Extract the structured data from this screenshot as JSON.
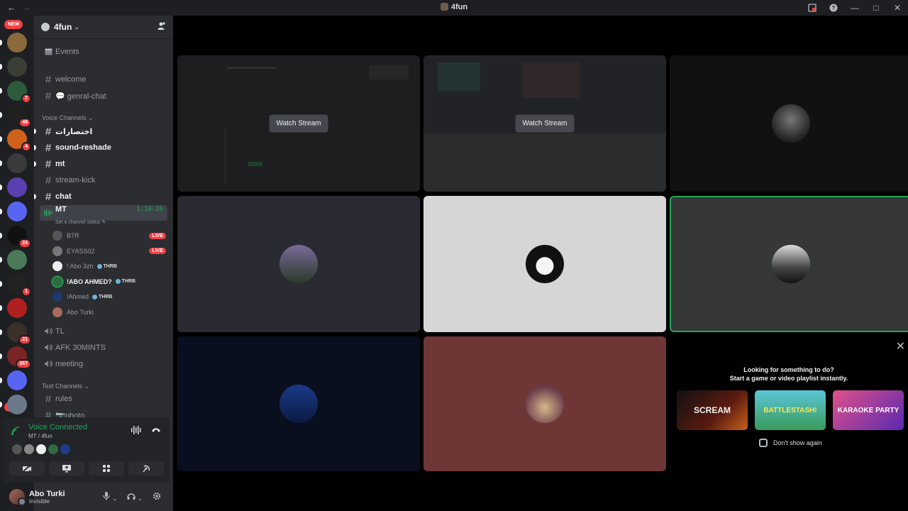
{
  "titlebar": {
    "title": "4fun",
    "back": "←",
    "forward": "→"
  },
  "rail": {
    "new_top": "NEW",
    "new_bottom": "NEW",
    "servers": [
      {
        "color": "#8a6a3a",
        "badge": ""
      },
      {
        "color": "#3a3f35",
        "badge": ""
      },
      {
        "color": "#2d5a3a",
        "badge": "7"
      },
      {
        "color": "#202020",
        "badge": "49"
      },
      {
        "color": "#d0611a",
        "badge": "4"
      },
      {
        "color": "#3a3a3a",
        "badge": ""
      },
      {
        "color": "#5a3fb0",
        "badge": ""
      },
      {
        "color": "#5865f2",
        "badge": ""
      },
      {
        "color": "#111111",
        "badge": "24"
      },
      {
        "color": "#4a7a58",
        "badge": ""
      },
      {
        "color": "#222222",
        "badge": "1"
      },
      {
        "color": "#b02020",
        "badge": ""
      },
      {
        "color": "#3a3028",
        "badge": "21"
      },
      {
        "color": "#7a2424",
        "badge": "267"
      },
      {
        "color": "#5865f2",
        "badge": ""
      },
      {
        "color": "#6a7a8a",
        "badge": ""
      }
    ]
  },
  "sidebar": {
    "server_name": "4fun",
    "events": "Events",
    "channels_top": [
      {
        "name": "welcome",
        "unread": false
      },
      {
        "name": "💬 genral-chat",
        "unread": false
      }
    ],
    "voice_category": "Voice Channels",
    "voice_text_channels": [
      {
        "name": "اختصارات",
        "unread": true
      },
      {
        "name": "sound-reshade",
        "unread": true
      },
      {
        "name": "mt",
        "unread": true
      },
      {
        "name": "stream-kick",
        "unread": false
      },
      {
        "name": "chat",
        "unread": true
      }
    ],
    "active_voice": {
      "name": "MT",
      "timer": "1:16:26",
      "status": "Set a channel status"
    },
    "voice_users": [
      {
        "name": "B7R",
        "live": "LIVE",
        "tag": "",
        "speaking": false,
        "color": "#555"
      },
      {
        "name": "EYASS02",
        "live": "LIVE",
        "tag": "",
        "speaking": false,
        "color": "#777"
      },
      {
        "name": "! Abo 3zh",
        "live": "",
        "tag": "THRB",
        "speaking": false,
        "color": "#eee"
      },
      {
        "name": "!ABO AHMED?",
        "live": "",
        "tag": "THRB",
        "speaking": true,
        "color": "#2f6b3f"
      },
      {
        "name": "!Ahmed",
        "live": "",
        "tag": "THRB",
        "speaking": false,
        "color": "#1e3a6b"
      },
      {
        "name": "Abo Turki",
        "live": "",
        "tag": "",
        "speaking": false,
        "color": "#a86b5c"
      }
    ],
    "voice_channels": [
      "TL",
      "AFK 30MINTS",
      "meeting"
    ],
    "text_category": "Text Channels",
    "text_channels": [
      "rules",
      "📷photo"
    ]
  },
  "rtc": {
    "title": "Voice Connected",
    "subtitle": "MT / 4fun"
  },
  "user": {
    "name": "Abo Turki",
    "status": "Invisible"
  },
  "stage": {
    "watch_label_1": "Watch Stream",
    "watch_label_2": "Watch Stream",
    "tiles": [
      {
        "bg": "#1d1e1f"
      },
      {
        "bg": "#222326"
      },
      {
        "bg": "#111111"
      },
      {
        "bg": "#2a2a33"
      },
      {
        "bg": "#d6d6d6"
      },
      {
        "bg": "#353836"
      },
      {
        "bg": "#090f1e"
      },
      {
        "bg": "#6e3736"
      }
    ]
  },
  "activity": {
    "heading": "Looking for something to do?",
    "subheading": "Start a game or video playlist instantly.",
    "games": [
      "SCREAM",
      "BATTLESTASH!",
      "KARAOKE PARTY"
    ],
    "dont_show": "Don't show again"
  }
}
